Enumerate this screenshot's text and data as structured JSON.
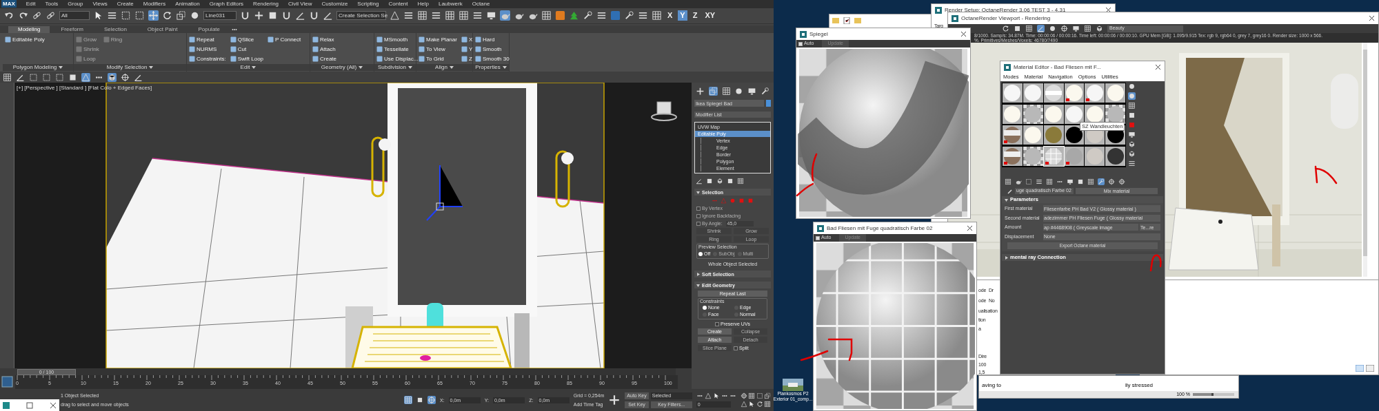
{
  "max": {
    "logo": "MAX",
    "menu": [
      "Edit",
      "Tools",
      "Group",
      "Views",
      "Create",
      "Modifiers",
      "Animation",
      "Graph Editors",
      "Rendering",
      "Civil View",
      "Customize",
      "Scripting",
      "Content",
      "Help",
      "Laubwerk",
      "Octane"
    ],
    "toolbar": {
      "filter": "All",
      "named_object": "Line031",
      "selection_set": "Create Selection Se"
    },
    "axes": [
      {
        "label": "X",
        "selected": false
      },
      {
        "label": "Y",
        "selected": true
      },
      {
        "label": "Z",
        "selected": false
      },
      {
        "label": "XY",
        "selected": false
      }
    ],
    "ribbon_tabs": [
      {
        "label": "Modeling",
        "selected": true
      },
      {
        "label": "Freeform",
        "selected": false
      },
      {
        "label": "Selection",
        "selected": false
      },
      {
        "label": "Object Paint",
        "selected": false
      },
      {
        "label": "Populate",
        "selected": false
      }
    ],
    "ribbon_groups": [
      {
        "title": "Polygon Modeling",
        "disabled": false,
        "items": [
          "Editable Poly"
        ]
      },
      {
        "title": "Modify Selection",
        "disabled": true,
        "items": [
          "Grow",
          "Shrink",
          "Loop",
          "Ring"
        ]
      },
      {
        "title": "Edit",
        "disabled": false,
        "items": [
          "Repeat",
          "NURMS",
          "Constraints:",
          "QSlice",
          "Cut",
          "Swift Loop",
          "P Connect"
        ]
      },
      {
        "title": "Geometry (All)",
        "disabled": false,
        "items": [
          "Relax",
          "Attach",
          "Create"
        ]
      },
      {
        "title": "Subdivision",
        "disabled": false,
        "items": [
          "MSmooth",
          "Tessellate",
          "Use Displac..."
        ]
      },
      {
        "title": "Align",
        "disabled": false,
        "items": [
          "Make Planar",
          "To View",
          "To Grid",
          "X",
          "Y",
          "Z"
        ]
      },
      {
        "title": "Properties",
        "disabled": false,
        "items": [
          "Hard",
          "Smooth",
          "Smooth 30"
        ]
      }
    ],
    "viewport_label": "[+] [Perspective ] [Standard ] [Flat Colo + Edged Faces]",
    "command_panel": {
      "object_name": "Ikea Spiegel Bad",
      "modifier_list": "Modifier List",
      "stack": [
        {
          "label": "UVW Map",
          "selected": false
        },
        {
          "label": "Editable Poly",
          "selected": true,
          "children": [
            {
              "label": "Vertex",
              "selected": false
            },
            {
              "label": "Edge",
              "selected": false
            },
            {
              "label": "Border",
              "selected": false
            },
            {
              "label": "Polygon",
              "selected": false
            },
            {
              "label": "Element",
              "selected": false
            }
          ]
        }
      ],
      "selection": {
        "title": "Selection",
        "expanded": true,
        "checks": [
          {
            "label": "By Vertex",
            "checked": false,
            "disabled": true
          },
          {
            "label": "Ignore Backfacing",
            "checked": false,
            "disabled": true
          },
          {
            "label": "By Angle:",
            "checked": false,
            "disabled": true
          }
        ],
        "angle": "45,0",
        "buttons": [
          {
            "label": "Shrink",
            "disabled": true
          },
          {
            "label": "Grow",
            "disabled": true
          },
          {
            "label": "Ring",
            "disabled": true
          },
          {
            "label": "Loop",
            "disabled": true
          }
        ],
        "preview_title": "Preview Selection",
        "preview": [
          {
            "label": "Off",
            "selected": true,
            "disabled": false
          },
          {
            "label": "SubObj",
            "selected": false,
            "disabled": true
          },
          {
            "label": "Multi",
            "selected": false,
            "disabled": true
          }
        ],
        "status": "Whole Object Selected"
      },
      "soft_selection": {
        "title": "Soft Selection",
        "expanded": false
      },
      "edit_geometry": {
        "title": "Edit Geometry",
        "expanded": true,
        "repeat": "Repeat Last",
        "constraints_title": "Constraints",
        "constraints": [
          {
            "label": "None",
            "selected": true
          },
          {
            "label": "Edge",
            "selected": false
          },
          {
            "label": "Face",
            "selected": false
          },
          {
            "label": "Normal",
            "selected": false
          }
        ],
        "preserve_uvs": {
          "label": "Preserve UVs",
          "checked": false
        },
        "buttons": [
          {
            "label": "Create",
            "disabled": false
          },
          {
            "label": "Collapse",
            "disabled": true
          },
          {
            "label": "Attach",
            "disabled": false
          },
          {
            "label": "Detach",
            "disabled": true
          },
          {
            "label": "Slice Plane",
            "disabled": true
          }
        ],
        "split": {
          "label": "Split",
          "checked": false
        }
      }
    },
    "timeline": {
      "position": "0 / 100",
      "ticks": [
        "0",
        "5",
        "10",
        "15",
        "20",
        "25",
        "30",
        "35",
        "40",
        "45",
        "50",
        "55",
        "60",
        "65",
        "70",
        "75",
        "80",
        "85",
        "90",
        "95",
        "100"
      ]
    },
    "status": {
      "selected": "1 Object Selected",
      "prompt": "drag to select and move objects",
      "coords": [
        {
          "label": "X:",
          "value": "0,0m"
        },
        {
          "label": "Y:",
          "value": "0,0m"
        },
        {
          "label": "Z:",
          "value": "0,0m"
        }
      ],
      "grid": "Grid = 0,254m",
      "time_tag": "Add Time Tag",
      "auto_key": "Auto Key",
      "key_mode": "Selected",
      "set_key": "Set Key",
      "key_filters": "Key Filters...",
      "frame": "0"
    }
  },
  "desktop": {
    "render_setup": {
      "title": "Render Setup: OctaneRender 3.06 TEST 3 - 4.31",
      "fragments": [
        "Targ",
        "ode",
        "Dr",
        "ode",
        "No",
        "ualisation",
        "tion",
        "a",
        "Dire",
        "100",
        "1,5"
      ]
    },
    "octane": {
      "title": "OctaneRender Viewport - Rendering",
      "pass": "Beauty",
      "stats": "8/1000.  Samp/s: 34.87M.  Time: 00:00:06 / 00:00:16.  Time left: 00:00:06 / 00:00:10.  GPU Mem [GB]: 1.095/9.915  Tex: rgb 9, rgb64 0, grey 7, grey16 0.  Render size: 1000 x 566.",
      "stats_2": "%.  Primitives/Meshes/Voxels: 46780/7490"
    },
    "previews": [
      {
        "title": "Spiegel",
        "auto": {
          "label": "Auto",
          "checked": true
        },
        "update": "Update",
        "kind": "mirror"
      },
      {
        "title": "Bad Fliesen mit Fuge quadratisch Farbe 02",
        "auto": {
          "label": "Auto",
          "checked": true
        },
        "update": "Update",
        "kind": "tiles"
      }
    ],
    "material_editor": {
      "title": "Material Editor - Bad Fliesen mit F...",
      "menu": [
        "Modes",
        "Material",
        "Navigation",
        "Options",
        "Utilities"
      ],
      "slots": [
        {
          "kind": "white",
          "marked": false,
          "selected": false
        },
        {
          "kind": "white",
          "marked": false,
          "selected": false
        },
        {
          "kind": "banded",
          "marked": false,
          "selected": false
        },
        {
          "kind": "cream",
          "marked": true,
          "selected": false
        },
        {
          "kind": "white",
          "marked": true,
          "selected": false
        },
        {
          "kind": "cream",
          "marked": false,
          "selected": false
        },
        {
          "kind": "cream",
          "marked": false,
          "selected": false
        },
        {
          "kind": "checker",
          "marked": false,
          "selected": false
        },
        {
          "kind": "cream",
          "marked": false,
          "selected": false
        },
        {
          "kind": "white",
          "marked": false,
          "selected": false
        },
        {
          "kind": "cream",
          "marked": false,
          "selected": false
        },
        {
          "kind": "checker",
          "marked": false,
          "selected": false
        },
        {
          "kind": "wood",
          "marked": true,
          "selected": false
        },
        {
          "kind": "cream",
          "marked": false,
          "selected": false
        },
        {
          "kind": "texture",
          "marked": false,
          "selected": false
        },
        {
          "kind": "black",
          "marked": false,
          "selected": false
        },
        {
          "kind": "grey",
          "marked": false,
          "selected": false
        },
        {
          "kind": "black",
          "marked": false,
          "selected": false
        },
        {
          "kind": "wood",
          "marked": true,
          "selected": false
        },
        {
          "kind": "checker",
          "marked": false,
          "selected": false
        },
        {
          "kind": "tiles",
          "marked": true,
          "selected": true
        },
        {
          "kind": "mirror",
          "marked": true,
          "selected": false
        },
        {
          "kind": "grey",
          "marked": false,
          "selected": false
        },
        {
          "kind": "dark",
          "marked": false,
          "selected": false
        }
      ],
      "tooltip": "SZ Wandleuchten",
      "material_name": "uge quadratisch Farbe 02",
      "material_type": "Mix material",
      "parameters": {
        "title": "Parameters",
        "expanded": true,
        "rows": [
          {
            "label": "First material",
            "value": "Fliesenfarbe PH Bad V2  ( Glossy material )"
          },
          {
            "label": "Second material",
            "value": "adezimmer PH Fliesen Fuge  ( Glossy material"
          },
          {
            "label": "Amount",
            "value": "ap #4468908  ( Greyscale image",
            "option": "Te...re"
          },
          {
            "label": "Displacement",
            "value": "None"
          }
        ],
        "export": "Export Octane material"
      },
      "mental_ray": {
        "title": "mental ray Connection",
        "expanded": false
      }
    },
    "document": {
      "text_1": "aving to",
      "text_2": "lly stressed",
      "zoom": "100 %",
      "level": 0.5
    },
    "desktop_icon": {
      "lines": [
        "Plankosmos P2",
        "Exterior 01_comp..."
      ]
    }
  }
}
